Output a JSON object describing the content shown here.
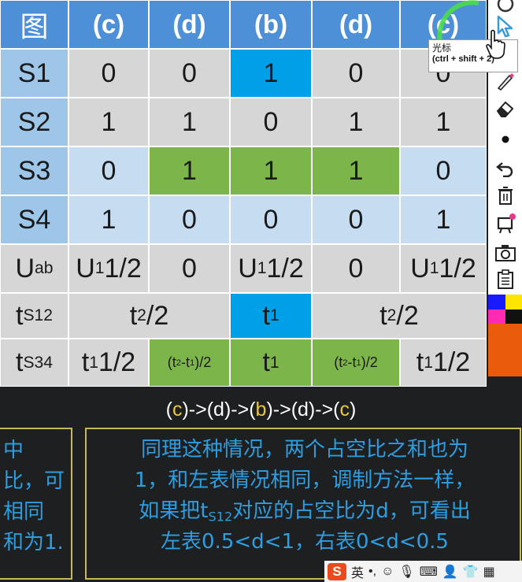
{
  "table": {
    "header": [
      "图",
      "(c)",
      "(d)",
      "(b)",
      "(d)",
      "(c)"
    ],
    "rows": [
      {
        "label": "S1",
        "cells": [
          "0",
          "0",
          "1",
          "0",
          "0"
        ]
      },
      {
        "label": "S2",
        "cells": [
          "1",
          "1",
          "0",
          "1",
          "1"
        ]
      },
      {
        "label": "S3",
        "cells": [
          "0",
          "1",
          "1",
          "1",
          "0"
        ]
      },
      {
        "label": "S4",
        "cells": [
          "1",
          "0",
          "0",
          "0",
          "1"
        ]
      }
    ],
    "uab": {
      "label": "ab",
      "label_main": "U",
      "c1": "1/2",
      "c2": "0",
      "c3": "1/2",
      "c4": "0",
      "c5": "1/2",
      "u": "U",
      "sub1": "1"
    },
    "ts12": {
      "label_main": "t",
      "label_sub": "S12",
      "left": "2/2",
      "mid": "1",
      "right": "2/2",
      "t": "t",
      "sub2": "2",
      "sub1": "1"
    },
    "ts34": {
      "label_main": "t",
      "label_sub": "S34",
      "c1": "1/2",
      "c2": "(t2-t1)/2",
      "c3": "1",
      "c4": "(t2-t1)/2",
      "c5": "1/2"
    }
  },
  "sequence": {
    "a": "c",
    "b": ")->(d)->(",
    "c": "b",
    "d": ")->(d)->(",
    "e": "c",
    "open": "(",
    "close": ")"
  },
  "left_box": {
    "lines": [
      "中",
      "比，可",
      "相同",
      "和为1."
    ]
  },
  "right_box": {
    "line1": "同理这种情况，两个占空比之和也为",
    "line2": "1，和左表情况相同，调制方法一样，",
    "line3a": "如果把t",
    "line3sub": "S12",
    "line3b": "对应的占空比为d，可看出",
    "line4": "左表0.5<d<1，右表0<d<0.5"
  },
  "tooltip": {
    "title": "光标",
    "shortcut": "(ctrl + shift + 2)"
  },
  "toolbar": {
    "icons": [
      "cursor-icon",
      "pen-icon",
      "eraser-icon",
      "dot-icon",
      "undo-icon",
      "trash-icon",
      "whiteboard-icon",
      "camera-icon",
      "clipboard-icon",
      "color-palette-icon"
    ]
  },
  "ime": {
    "logo": "S",
    "lang": "英",
    "punct": "•,"
  },
  "colors": {
    "header_blue": "#4d90d8",
    "label_blue": "#9ec6e8",
    "gray": "#d6d6d6",
    "bright_blue": "#00a0e9",
    "green": "#7cb54a",
    "light_blue": "#c6dcf0",
    "text_blue": "#2d9ee0",
    "box_border": "#c9b85a",
    "seq_yellow": "#e8c73a"
  }
}
